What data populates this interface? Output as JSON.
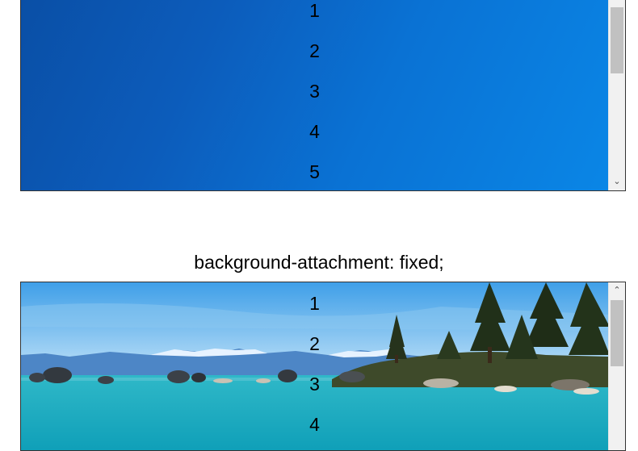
{
  "top_demo": {
    "items": [
      "1",
      "2",
      "3",
      "4",
      "5"
    ],
    "scrollbar": {
      "down_arrow_icon": "chevron-down-icon"
    }
  },
  "bottom_demo": {
    "caption": "background-attachment: fixed;",
    "items": [
      "1",
      "2",
      "3",
      "4"
    ],
    "scrollbar": {
      "up_arrow_icon": "chevron-up-icon"
    }
  },
  "colors": {
    "blue_background": "#0a72d4",
    "border": "#333333",
    "scroll_thumb": "#c1c1c1",
    "scroll_track": "#f1f1f1"
  }
}
